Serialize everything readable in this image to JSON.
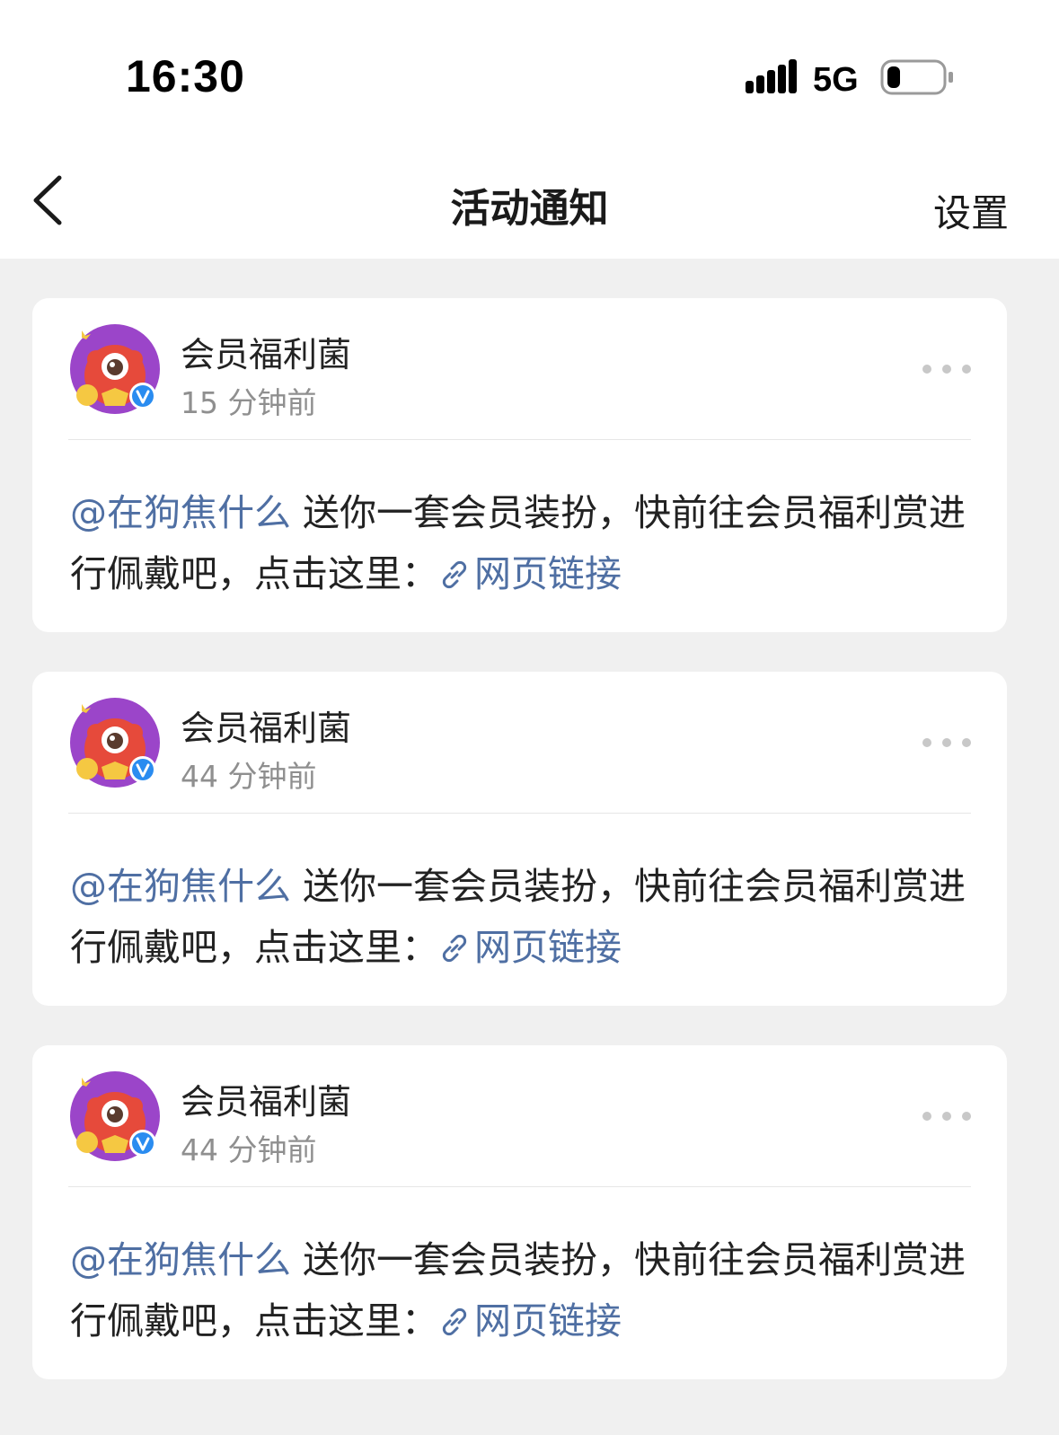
{
  "status_bar": {
    "time": "16:30",
    "network": "5G"
  },
  "nav": {
    "title": "活动通知",
    "settings": "设置"
  },
  "notifications": [
    {
      "sender": "会员福利菌",
      "time_ago": "15 分钟前",
      "mention": "@在狗焦什么",
      "message": " 送你一套会员装扮，快前往会员福利赏进行佩戴吧，点击这里：",
      "link_label": "网页链接"
    },
    {
      "sender": "会员福利菌",
      "time_ago": "44 分钟前",
      "mention": "@在狗焦什么",
      "message": " 送你一套会员装扮，快前往会员福利赏进行佩戴吧，点击这里：",
      "link_label": "网页链接"
    },
    {
      "sender": "会员福利菌",
      "time_ago": "44 分钟前",
      "mention": "@在狗焦什么",
      "message": " 送你一套会员装扮，快前往会员福利赏进行佩戴吧，点击这里：",
      "link_label": "网页链接"
    }
  ],
  "colors": {
    "link": "#4f6fa3",
    "verified": "#2a8cf0",
    "avatar_bg": "#9b45c9",
    "mascot": "#e64a3b"
  },
  "icons": {
    "back": "chevron-left-icon",
    "more": "more-dots-icon",
    "verified": "verified-badge-icon",
    "link": "link-icon"
  }
}
